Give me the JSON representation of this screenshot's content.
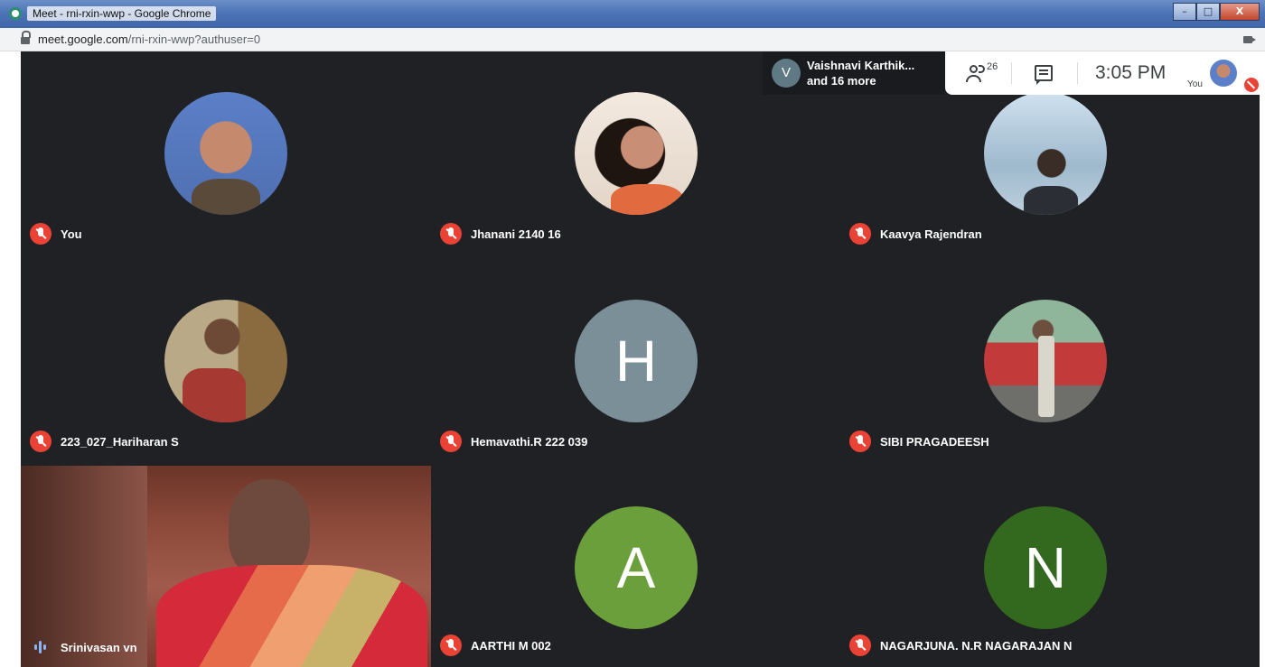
{
  "window": {
    "title": "Meet - rni-rxin-wwp - Google Chrome",
    "buttons": {
      "minimize": "–",
      "maximize": "□",
      "close": "X"
    }
  },
  "address": {
    "host": "meet.google.com",
    "path": "/rni-rxin-wwp?authuser=0"
  },
  "pinned": {
    "initial": "V",
    "line1": "Vaishnavi Karthik...",
    "line2": "and 16 more"
  },
  "toolbar": {
    "people_count": "26",
    "time": "3:05 PM",
    "you_label": "You"
  },
  "tiles": [
    {
      "name": "You"
    },
    {
      "name": "Jhanani 2140 16"
    },
    {
      "name": "Kaavya Rajendran"
    },
    {
      "name": "223_027_Hariharan S"
    },
    {
      "name": "Hemavathi.R 222 039",
      "initial": "H",
      "color": "#7b8f99"
    },
    {
      "name": "SIBI PRAGADEESH"
    },
    {
      "name": "Srinivasan vn"
    },
    {
      "name": "AARTHI M 002",
      "initial": "A",
      "color": "#6b9f3b"
    },
    {
      "name": "NAGARJUNA. N.R NAGARAJAN N",
      "initial": "N",
      "color": "#33691e"
    }
  ]
}
